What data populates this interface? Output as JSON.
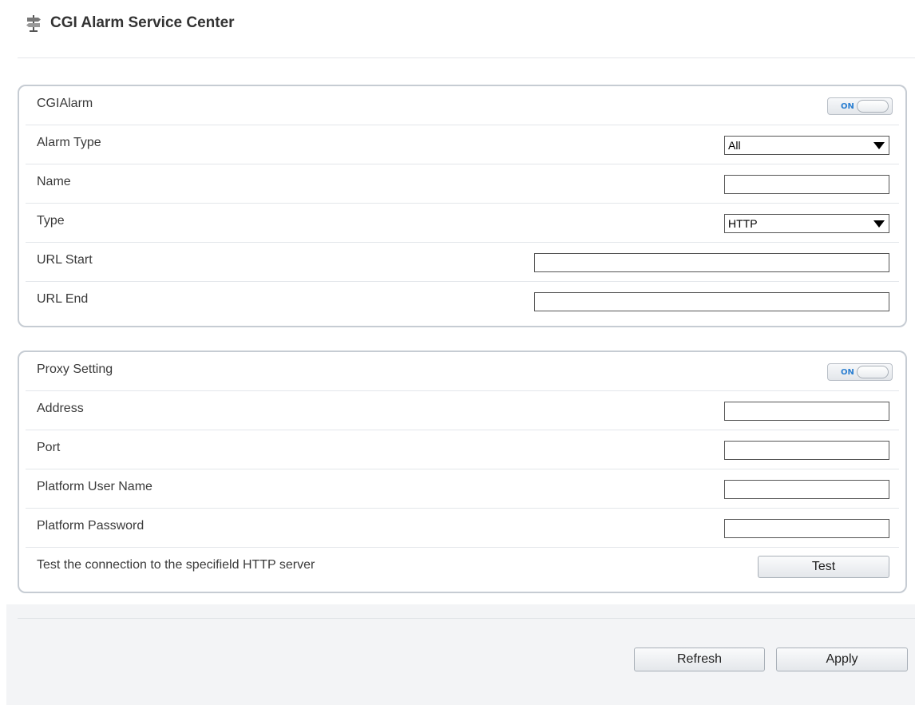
{
  "header": {
    "title": "CGI Alarm Service Center",
    "icon": "signpost-icon"
  },
  "cgi_panel": {
    "toggle_row_label": "CGIAlarm",
    "toggle_state": "ON",
    "alarm_type_label": "Alarm Type",
    "alarm_type_value": "All",
    "name_label": "Name",
    "name_value": "",
    "type_label": "Type",
    "type_value": "HTTP",
    "url_start_label": "URL Start",
    "url_start_value": "",
    "url_end_label": "URL End",
    "url_end_value": ""
  },
  "proxy_panel": {
    "toggle_row_label": "Proxy Setting",
    "toggle_state": "ON",
    "address_label": "Address",
    "address_value": "",
    "port_label": "Port",
    "port_value": "",
    "user_label": "Platform User Name",
    "user_value": "",
    "password_label": "Platform Password",
    "password_value": "",
    "test_label": "Test the connection to the specifield HTTP server",
    "test_button": "Test"
  },
  "footer": {
    "refresh_button": "Refresh",
    "apply_button": "Apply"
  },
  "colors": {
    "toggle_on_text": "#2b7fd1",
    "panel_border": "#c6ccd3",
    "footer_bg": "#f3f4f6"
  }
}
